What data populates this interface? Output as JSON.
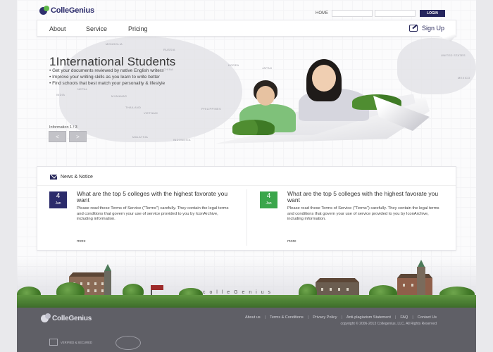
{
  "header": {
    "logo_text": "ColleGenius",
    "home_label": "HOME",
    "login_label": "LOGIN"
  },
  "nav": {
    "items": [
      {
        "label": "About"
      },
      {
        "label": "Service"
      },
      {
        "label": "Pricing"
      }
    ],
    "signup_label": "Sign Up"
  },
  "hero": {
    "title": "1International Students",
    "bullets": [
      "Get your documents reviewed by native English writers",
      "Improve your writing skills as you learn to write better",
      "Find schools that best match your personality & lifestyle"
    ],
    "counter": "Information 1 / 3",
    "prev_label": "<",
    "next_label": ">",
    "map_labels": [
      "MONGOLIA",
      "CHINA",
      "KOREA",
      "JAPAN",
      "INDIA",
      "NEPAL",
      "MYANMAR",
      "THAILAND",
      "VIETNAM",
      "PHILIPPINES",
      "MALAYSIA",
      "INDONESIA",
      "UNITED STATES",
      "MEXICO",
      "RUSSIA"
    ]
  },
  "news": {
    "title": "News & Notice",
    "articles": [
      {
        "day": "4",
        "month": "Jan",
        "badge_color": "#2b2b6b",
        "title": "What are the top 5 colleges with the highest favorate you want",
        "body": "Please read these Terms of Service (\"Terms\") carefully. They contain the legal terms and conditions that govern your use of service provided to you by IconArchive, including information.",
        "more": "more"
      },
      {
        "day": "4",
        "month": "Jan",
        "badge_color": "#3aa64b",
        "title": "What are the top 5 colleges with the highest favorate you want",
        "body": "Please read these Terms of Service (\"Terms\") carefully. They contain the legal terms and conditions that govern your use of service provided to you by IconArchive, including information.",
        "more": "more"
      }
    ]
  },
  "scenery": {
    "scatter_text": "c o l l e G e n i u s"
  },
  "footer": {
    "logo_text": "ColleGenius",
    "links": [
      "About us",
      "Terms & Conditions",
      "Privacy Policy",
      "Anti-plagiarism Statement",
      "FAQ",
      "Contact Us"
    ],
    "copyright": "copyright © 2006-2013 Collegenius, LLC. All Rights Reserved",
    "badge_text": "VERIFIED & SECURED"
  }
}
